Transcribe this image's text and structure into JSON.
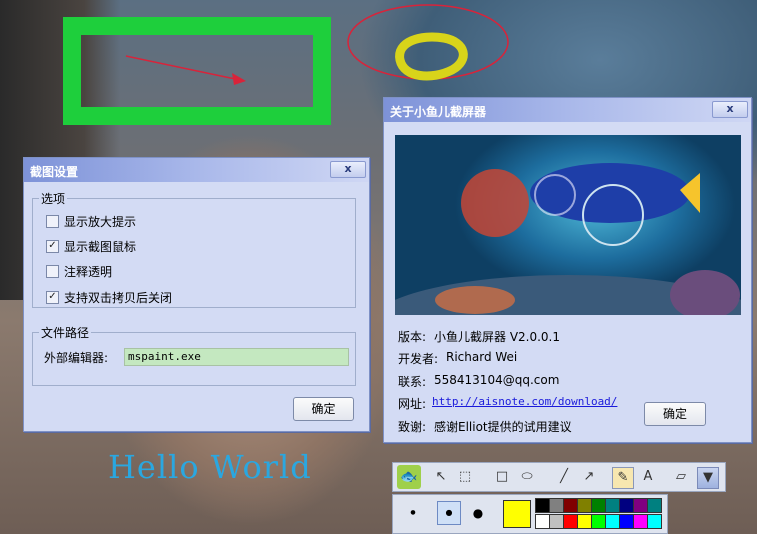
{
  "desktop": {
    "hello_text": "Hello World"
  },
  "settings_window": {
    "title": "截图设置",
    "close_label": "x",
    "options_legend": "选项",
    "options": [
      {
        "label": "显示放大提示",
        "checked": false
      },
      {
        "label": "显示截图鼠标",
        "checked": true
      },
      {
        "label": "注释透明",
        "checked": false
      },
      {
        "label": "支持双击拷贝后关闭",
        "checked": true
      }
    ],
    "path_legend": "文件路径",
    "editor_label": "外部编辑器:",
    "editor_value": "mspaint.exe",
    "ok_label": "确定"
  },
  "about_window": {
    "title": "关于小鱼儿截屏器",
    "close_label": "x",
    "version_label": "版本:",
    "version_value": "小鱼儿截屏器 V2.0.0.1",
    "developer_label": "开发者:",
    "developer_value": "Richard Wei",
    "contact_label": "联系:",
    "contact_value": "558413104@qq.com",
    "website_label": "网址:",
    "website_value": "http://aisnote.com/download/",
    "thanks_label": "致谢:",
    "thanks_value": "感谢Elliot提供的试用建议",
    "ok_label": "确定"
  },
  "annotation_toolbar": {
    "tools": [
      "pointer-icon",
      "select-icon",
      "rectangle-icon",
      "ellipse-icon",
      "line-icon",
      "arrow-icon",
      "pencil-icon",
      "text-icon",
      "eraser-icon",
      "dropdown-icon"
    ],
    "text_tool_label": "A",
    "selected_tool": "pencil-icon"
  },
  "palette_toolbar": {
    "brush_sizes": [
      "small",
      "medium",
      "large"
    ],
    "selected_size": "medium",
    "current_color": "#ffff00",
    "colors_row1": [
      "#000000",
      "#808080",
      "#800000",
      "#808000",
      "#008000",
      "#008080",
      "#000080",
      "#800080",
      "#008080"
    ],
    "colors_row2": [
      "#ffffff",
      "#c0c0c0",
      "#ff0000",
      "#ffff00",
      "#00ff00",
      "#00ffff",
      "#0000ff",
      "#ff00ff",
      "#00ffff"
    ]
  },
  "colors": {
    "title_start": "#7d92d8",
    "window_bg": "#d3dbf4",
    "annotation_green": "#1ecf3c",
    "annotation_red": "#d9233a",
    "annotation_yellow": "#d8d41a",
    "hello_color": "#2aa7e0"
  }
}
